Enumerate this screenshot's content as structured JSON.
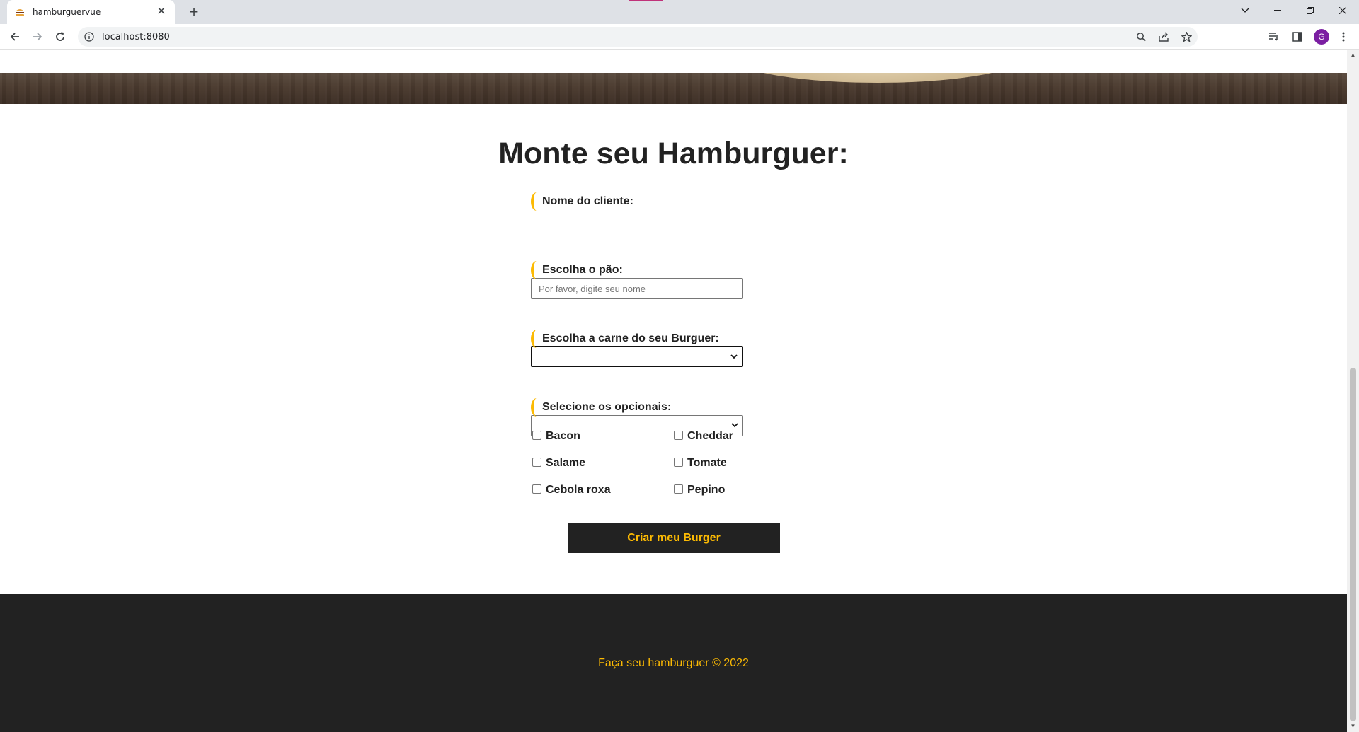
{
  "browser": {
    "tab_title": "hamburguervue",
    "url": "localhost:8080",
    "avatar_letter": "G"
  },
  "page": {
    "title": "Monte seu Hamburguer:",
    "name_label": "Nome do cliente:",
    "name_placeholder": "Por favor, digite seu nome",
    "name_value": "",
    "bread_label": "Escolha o pão:",
    "bread_selected": "",
    "meat_label": "Escolha a carne do seu Burguer:",
    "meat_selected": "",
    "optionals_label": "Selecione os opcionais:",
    "optionals": [
      {
        "label": "Bacon",
        "checked": false
      },
      {
        "label": "Cheddar",
        "checked": false
      },
      {
        "label": "Salame",
        "checked": false
      },
      {
        "label": "Tomate",
        "checked": false
      },
      {
        "label": "Cebola roxa",
        "checked": false
      },
      {
        "label": "Pepino",
        "checked": false
      }
    ],
    "submit_label": "Criar meu Burger"
  },
  "footer": {
    "text": "Faça seu hamburguer © 2022"
  },
  "colors": {
    "accent": "#fcba03",
    "dark": "#222222",
    "avatar": "#7b1fa2"
  }
}
